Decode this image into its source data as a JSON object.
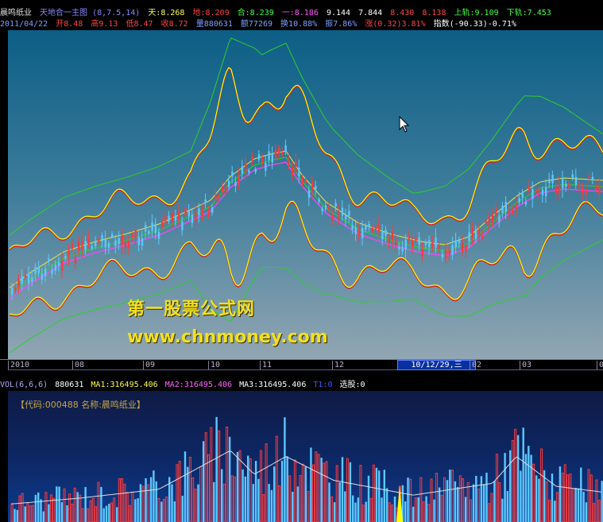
{
  "header": {
    "stock_name": "晨鸣纸业",
    "formula_name": "天地合一主图",
    "formula_params": "(8,7.5,14)",
    "tian": "天:8.268",
    "di": "地:8.209",
    "he": "合:8.239",
    "yi": "一:8.186",
    "v1": "9.144",
    "v2": "7.844",
    "v3": "8.430",
    "v4": "8.138",
    "upper": "上轨:9.109",
    "lower": "下轨:7.453"
  },
  "quote": {
    "date": "2011/04/22",
    "open": "开8.48",
    "high": "高9.13",
    "low": "低8.47",
    "close": "收8.72",
    "volume": "量880631",
    "amount": "额77269",
    "turnover": "换10.88%",
    "amplitude": "振7.86%",
    "change": "涨(0.32)3.81%",
    "index": "指数(-90.33)-0.71%"
  },
  "watermark": {
    "line1": "第一股票公式网",
    "line2": "www.chnmoney.com"
  },
  "date_axis": {
    "labels": [
      "2010",
      "08",
      "09",
      "10",
      "11",
      "12",
      "02",
      "03",
      "0"
    ],
    "highlight": "10/12/29,三"
  },
  "volume_indicator": {
    "name": "VOL(6,6,6)",
    "vol": "880631",
    "ma1": "MA1:316495.406",
    "ma2": "MA2:316495.406",
    "ma3": "MA3:316495.406",
    "t1": "T1:0",
    "xuangu": "选股:0"
  },
  "stock_label": "【代码:000488 名称:晨鸣纸业】",
  "colors": {
    "rise": "#ff3a3a",
    "fall": "#5cc8ff",
    "yellow": "#ffff00",
    "green": "#2ad12a",
    "magenta": "#ff44ff",
    "red_line": "#d92020",
    "vol_ma": "#dddddd"
  }
}
